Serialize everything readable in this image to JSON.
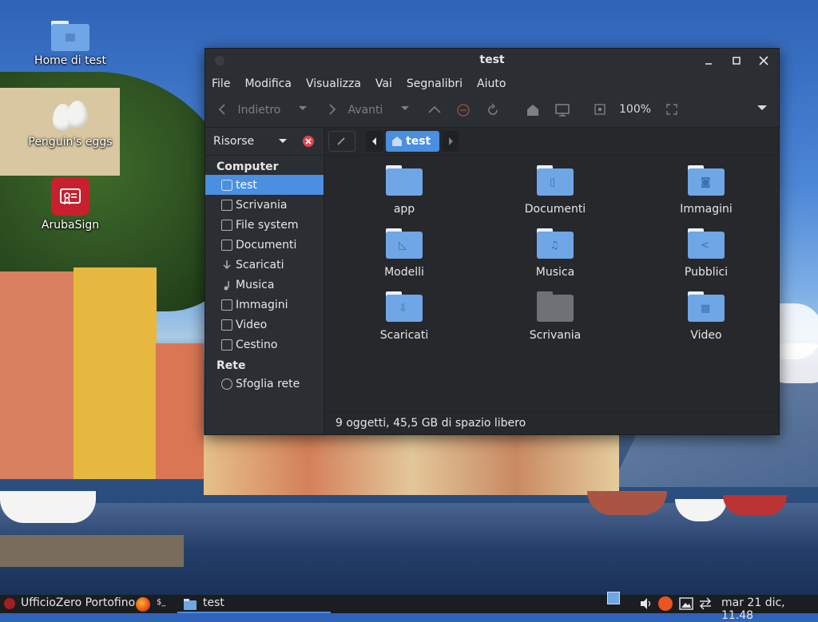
{
  "desktop": {
    "icons": [
      {
        "label": "Home di test"
      },
      {
        "label": "Penguin's eggs"
      },
      {
        "label": "ArubaSign"
      }
    ]
  },
  "window": {
    "title": "test",
    "menu": [
      "File",
      "Modifica",
      "Visualizza",
      "Vai",
      "Segnalibri",
      "Aiuto"
    ],
    "toolbar": {
      "back_label": "Indietro",
      "forward_label": "Avanti",
      "zoom": "100%"
    },
    "sidebar": {
      "header_label": "Risorse",
      "sections": [
        {
          "title": "Computer",
          "items": [
            "test",
            "Scrivania",
            "File system",
            "Documenti",
            "Scaricati",
            "Musica",
            "Immagini",
            "Video",
            "Cestino"
          ]
        },
        {
          "title": "Rete",
          "items": [
            "Sfoglia rete"
          ]
        }
      ],
      "selected": "test"
    },
    "pathbar": {
      "current": "test"
    },
    "files": [
      "app",
      "Documenti",
      "Immagini",
      "Modelli",
      "Musica",
      "Pubblici",
      "Scaricati",
      "Scrivania",
      "Video"
    ],
    "status": "9 oggetti, 45,5 GB di spazio libero"
  },
  "taskbar": {
    "start_label": "UfficioZero Portofino",
    "terminal_label": "$_",
    "task_label": "test",
    "clock": "mar 21 dic, 11.48"
  }
}
